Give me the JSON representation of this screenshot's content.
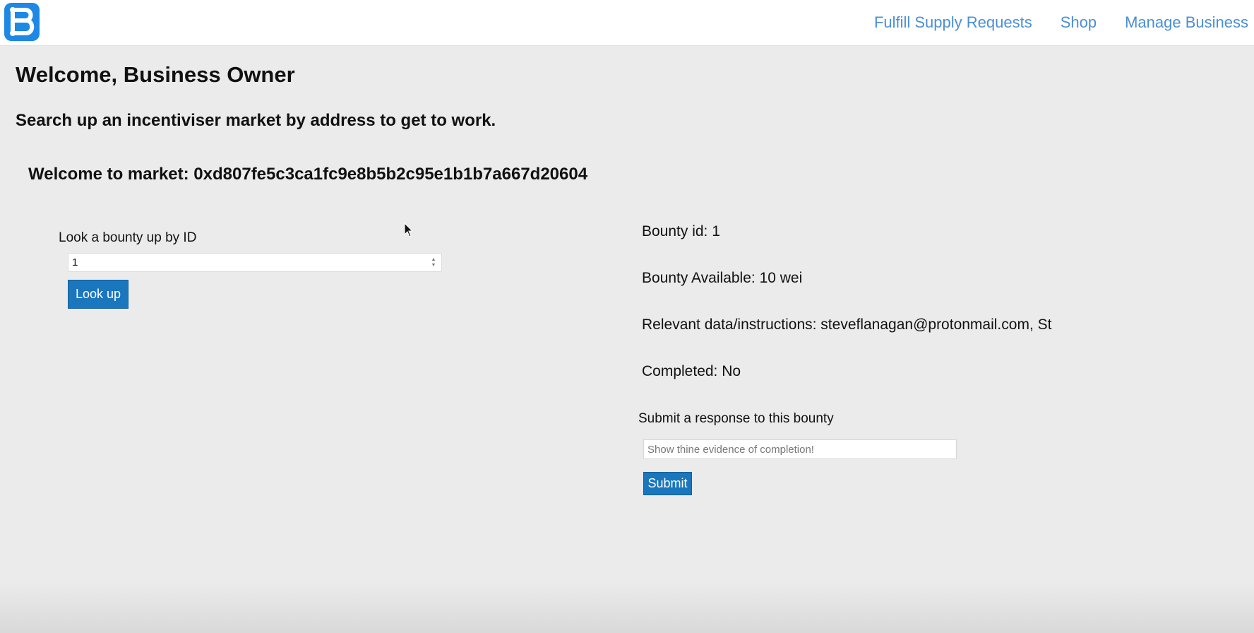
{
  "nav": {
    "logo_icon": "b-logo-icon",
    "brand_color": "#1e88e5",
    "links": [
      {
        "label": "Fulfill Supply Requests"
      },
      {
        "label": "Shop"
      },
      {
        "label": "Manage Business"
      }
    ],
    "link_color": "#4a8fd6"
  },
  "main": {
    "welcome_title": "Welcome, Business Owner",
    "subtitle": "Search up an incentiviser market by address to get to work.",
    "market_heading": "Welcome to market: 0xd807fe5c3ca1fc9e8b5b2c95e1b1b7a667d20604"
  },
  "lookup": {
    "label": "Look a bounty up by ID",
    "value": "1",
    "button_label": "Look up"
  },
  "bounty": {
    "id_line": "Bounty id: 1",
    "available_line": "Bounty Available: 10 wei",
    "instructions_line": "Relevant data/instructions: steveflanagan@protonmail.com, St",
    "completed_line": "Completed: No"
  },
  "response": {
    "label": "Submit a response to this bounty",
    "placeholder": "Show thine evidence of completion!",
    "value": "",
    "button_label": "Submit"
  },
  "colors": {
    "button_bg": "#1a76bd",
    "page_bg": "#ebebeb"
  }
}
